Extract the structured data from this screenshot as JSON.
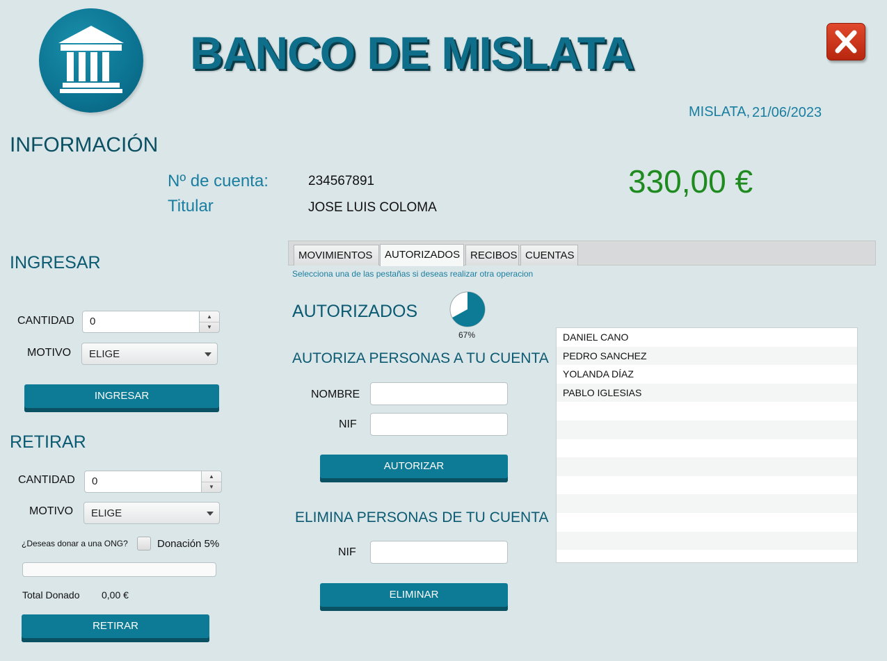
{
  "header": {
    "title": "BANCO DE MISLATA",
    "place": "MISLATA,",
    "date": "21/06/2023"
  },
  "info": {
    "heading": "INFORMACIÓN",
    "account_label": "Nº de cuenta:",
    "account_value": "234567891",
    "holder_label": "Titular",
    "holder_value": "JOSE LUIS COLOMA",
    "balance": "330,00 €"
  },
  "ingresar": {
    "heading": "INGRESAR",
    "cantidad_label": "CANTIDAD",
    "cantidad_value": "0",
    "motivo_label": "MOTIVO",
    "motivo_value": "ELIGE",
    "button": "INGRESAR"
  },
  "retirar": {
    "heading": "RETIRAR",
    "cantidad_label": "CANTIDAD",
    "cantidad_value": "0",
    "motivo_label": "MOTIVO",
    "motivo_value": "ELIGE",
    "ong_question": "¿Deseas donar a una ONG?",
    "donation_label": "Donación 5%",
    "total_label": "Total Donado",
    "total_value": "0,00 €",
    "button": "RETIRAR"
  },
  "tabs": [
    {
      "label": "MOVIMIENTOS",
      "active": false
    },
    {
      "label": "AUTORIZADOS",
      "active": true
    },
    {
      "label": "RECIBOS",
      "active": false
    },
    {
      "label": "CUENTAS",
      "active": false
    }
  ],
  "hint": "Selecciona una de las pestañas si deseas realizar otra operacion",
  "autorizados": {
    "heading": "AUTORIZADOS",
    "progress_percent": 67,
    "progress_label": "67%",
    "authorize_heading": "AUTORIZA PERSONAS A TU CUENTA",
    "nombre_label": "NOMBRE",
    "nombre_value": "",
    "nif_label": "NIF",
    "nif_value": "",
    "authorize_button": "AUTORIZAR",
    "remove_heading": "ELIMINA PERSONAS DE TU CUENTA",
    "remove_nif_label": "NIF",
    "remove_nif_value": "",
    "remove_button": "ELIMINAR",
    "people": [
      "DANIEL CANO",
      "PEDRO SANCHEZ",
      "YOLANDA DÍAZ",
      "PABLO IGLESIAS",
      "",
      "",
      "",
      "",
      "",
      "",
      "",
      "",
      ""
    ]
  },
  "colors": {
    "accent": "#0d7a96",
    "balance": "#1f8a1f",
    "close": "#d23a1f",
    "background": "#dbe6e8"
  },
  "icons": {
    "logo": "bank-building-icon",
    "close": "close-icon"
  }
}
